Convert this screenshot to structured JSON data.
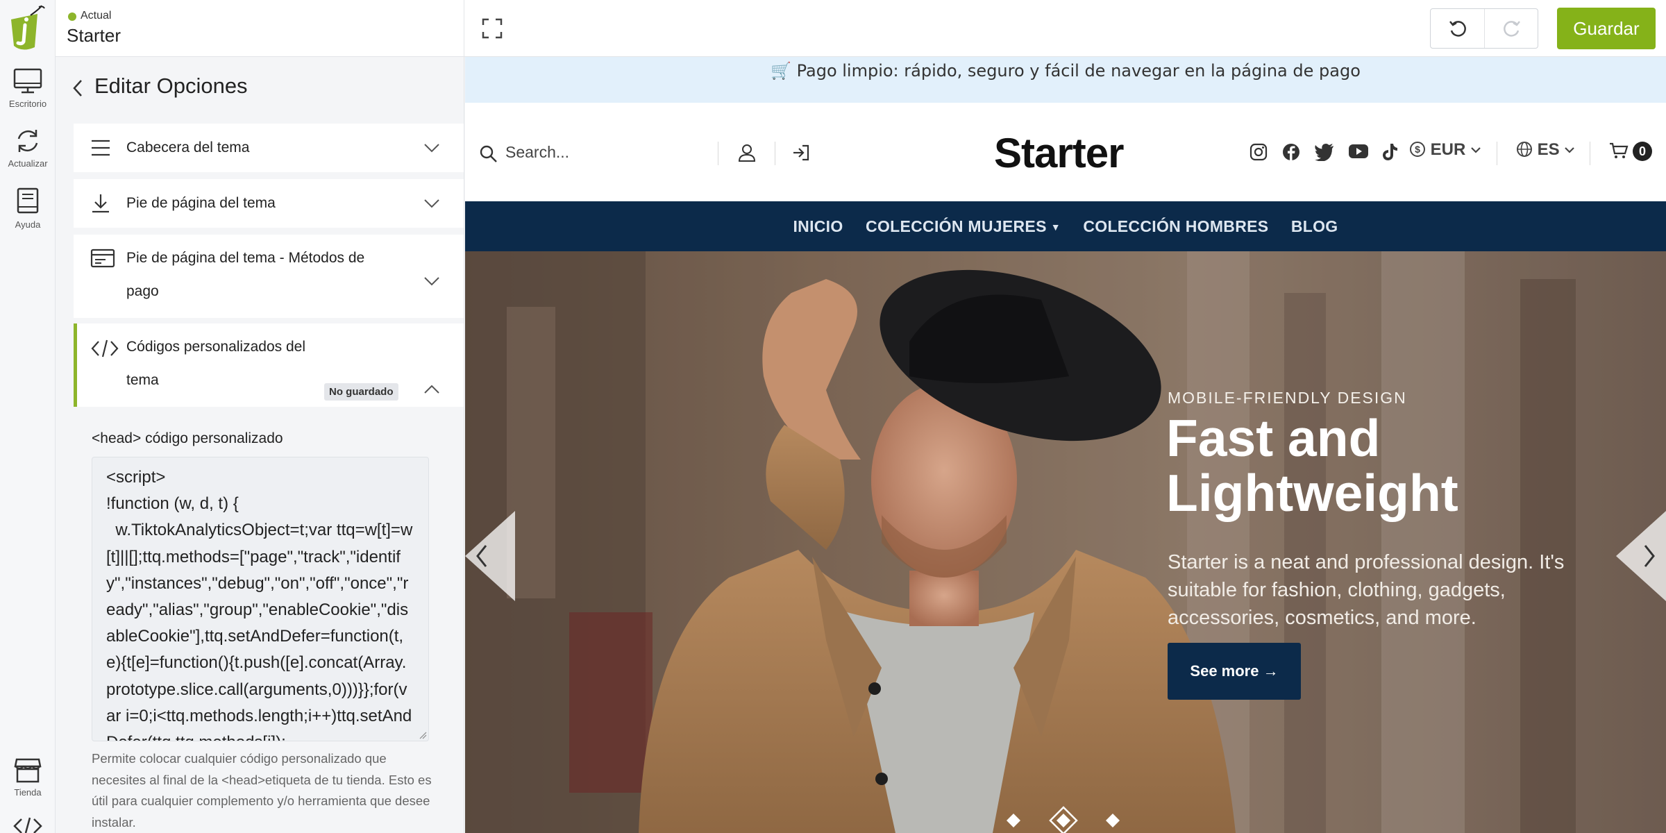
{
  "app": {
    "status_label": "Actual",
    "site_name": "Starter",
    "save_label": "Guardar"
  },
  "rail": {
    "items": [
      {
        "label": "Escritorio",
        "icon": "desktop-icon"
      },
      {
        "label": "Actualizar",
        "icon": "refresh-icon"
      },
      {
        "label": "Ayuda",
        "icon": "book-icon"
      }
    ],
    "bottom_items": [
      {
        "label": "Tienda",
        "icon": "store-icon"
      },
      {
        "label": "",
        "icon": "code-icon"
      }
    ]
  },
  "panel": {
    "title": "Editar Opciones",
    "sections": [
      {
        "label": "Cabecera del tema",
        "icon": "menu-lines-icon",
        "expanded": false
      },
      {
        "label": "Pie de página del tema",
        "icon": "download-icon",
        "expanded": false
      },
      {
        "label": "Pie de página del tema - Métodos de pago",
        "icon": "credit-card-icon",
        "expanded": false
      },
      {
        "label": "Códigos personalizados del tema",
        "icon": "code-icon",
        "expanded": true,
        "badge": "No guardado"
      }
    ],
    "head_code": {
      "label": "<head> código personalizado",
      "value": "<script>\n!function (w, d, t) {\n  w.TiktokAnalyticsObject=t;var ttq=w[t]=w[t]||[];ttq.methods=[\"page\",\"track\",\"identify\",\"instances\",\"debug\",\"on\",\"off\",\"once\",\"ready\",\"alias\",\"group\",\"enableCookie\",\"disableCookie\"],ttq.setAndDefer=function(t,e){t[e]=function(){t.push([e].concat(Array.prototype.slice.call(arguments,0)))}};for(var i=0;i<ttq.methods.length;i++)ttq.setAndDefer(ttq,ttq.methods[i]);",
      "help": "Permite colocar cualquier código personalizado que necesites al final de la <head>etiqueta de tu tienda. Esto es útil para cualquier complemento y/o herramienta que desee instalar."
    }
  },
  "preview": {
    "promo": "🛒 Pago limpio: rápido, seguro y fácil de navegar en la página de pago",
    "search_placeholder": "Search...",
    "brand": "Starter",
    "currency": "EUR",
    "language": "ES",
    "cart_count": "0",
    "social_icons": [
      "instagram-icon",
      "facebook-icon",
      "twitter-icon",
      "youtube-icon",
      "tiktok-icon"
    ],
    "nav": [
      {
        "label": "INICIO",
        "has_dropdown": false
      },
      {
        "label": "COLECCIÓN MUJERES",
        "has_dropdown": true
      },
      {
        "label": "COLECCIÓN HOMBRES",
        "has_dropdown": false
      },
      {
        "label": "BLOG",
        "has_dropdown": false
      }
    ],
    "hero": {
      "eyebrow": "MOBILE-FRIENDLY DESIGN",
      "title": "Fast and Lightweight",
      "subtitle": "Starter is a neat and professional design. It's suitable for fashion, clothing, gadgets, accessories, cosmetics, and more.",
      "cta": "See more →",
      "slides_total": 3,
      "active_slide": 2
    }
  },
  "colors": {
    "accent_green": "#85b219",
    "navy": "#0c2a4a",
    "promo_bg": "#e2f0fb"
  }
}
